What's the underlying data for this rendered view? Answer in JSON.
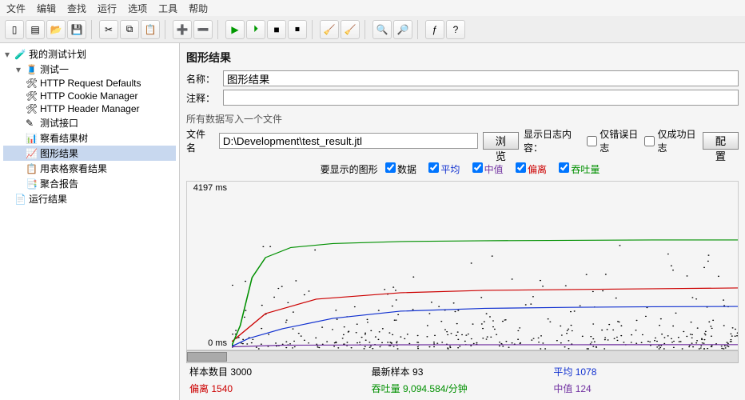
{
  "menu": [
    "文件",
    "编辑",
    "查找",
    "运行",
    "选项",
    "工具",
    "帮助"
  ],
  "tree": {
    "root": "我的测试计划",
    "child1": "测试一",
    "items": [
      "HTTP Request Defaults",
      "HTTP Cookie Manager",
      "HTTP Header Manager",
      "测试接口",
      "察看结果树",
      "图形结果",
      "用表格察看结果",
      "聚合报告"
    ],
    "last": "运行结果"
  },
  "panel": {
    "title": "图形结果",
    "name_label": "名称：",
    "name_value": "图形结果",
    "comment_label": "注释：",
    "comment_value": "",
    "note": "所有数据写入一个文件",
    "file_label": "文件名",
    "file_value": "D:\\Development\\test_result.jtl",
    "browse": "浏览",
    "log_label": "显示日志内容：",
    "err_only": "仅错误日志",
    "ok_only": "仅成功日志",
    "config": "配置"
  },
  "legend": {
    "title": "要显示的图形",
    "data": "数据",
    "avg": "平均",
    "median": "中值",
    "dev": "偏离",
    "thr": "吞吐量"
  },
  "axis": {
    "top": "4197 ms",
    "bottom": "0 ms"
  },
  "stats": {
    "samples_label": "样本数目",
    "samples": "3000",
    "dev_label": "偏离",
    "dev": "1540",
    "latest_label": "最新样本",
    "latest": "93",
    "thr_label": "吞吐量",
    "thr": "9,094.584/分钟",
    "avg_label": "平均",
    "avg": "1078",
    "median_label": "中值",
    "median": "124"
  },
  "chart_data": {
    "type": "line",
    "x_range": [
      0,
      3000
    ],
    "y_range_ms": [
      0,
      4197
    ],
    "series": [
      {
        "name": "数据",
        "color": "#000",
        "style": "scatter",
        "points_sampled": [
          [
            5,
            80
          ],
          [
            20,
            2800
          ],
          [
            40,
            180
          ],
          [
            60,
            480
          ],
          [
            100,
            620
          ],
          [
            140,
            900
          ],
          [
            180,
            2400
          ],
          [
            220,
            700
          ],
          [
            300,
            450
          ],
          [
            400,
            850
          ],
          [
            500,
            1050
          ],
          [
            700,
            2400
          ],
          [
            900,
            600
          ],
          [
            1100,
            120
          ],
          [
            1300,
            3100
          ],
          [
            1500,
            550
          ],
          [
            1700,
            180
          ],
          [
            1900,
            2000
          ],
          [
            2100,
            700
          ],
          [
            2300,
            200
          ],
          [
            2500,
            2800
          ],
          [
            2700,
            1400
          ],
          [
            2900,
            450
          ]
        ]
      },
      {
        "name": "平均",
        "color": "#1030d0",
        "style": "line",
        "points": [
          [
            0,
            80
          ],
          [
            100,
            280
          ],
          [
            300,
            520
          ],
          [
            600,
            780
          ],
          [
            1000,
            960
          ],
          [
            1500,
            1030
          ],
          [
            2000,
            1055
          ],
          [
            2500,
            1070
          ],
          [
            3000,
            1078
          ]
        ]
      },
      {
        "name": "中值",
        "color": "#7030a0",
        "style": "line",
        "points": [
          [
            0,
            70
          ],
          [
            300,
            110
          ],
          [
            1000,
            120
          ],
          [
            2000,
            122
          ],
          [
            3000,
            124
          ]
        ]
      },
      {
        "name": "偏离",
        "color": "#cc0000",
        "style": "line",
        "points": [
          [
            0,
            200
          ],
          [
            200,
            900
          ],
          [
            500,
            1260
          ],
          [
            1000,
            1420
          ],
          [
            1500,
            1480
          ],
          [
            2000,
            1500
          ],
          [
            2500,
            1520
          ],
          [
            3000,
            1540
          ]
        ]
      },
      {
        "name": "吞吐量",
        "color": "#009000",
        "style": "line",
        "points": [
          [
            0,
            100
          ],
          [
            50,
            600
          ],
          [
            120,
            1800
          ],
          [
            200,
            2300
          ],
          [
            350,
            2550
          ],
          [
            600,
            2650
          ],
          [
            1000,
            2700
          ],
          [
            1500,
            2720
          ],
          [
            2000,
            2730
          ],
          [
            2500,
            2740
          ],
          [
            3000,
            2740
          ]
        ]
      }
    ]
  }
}
